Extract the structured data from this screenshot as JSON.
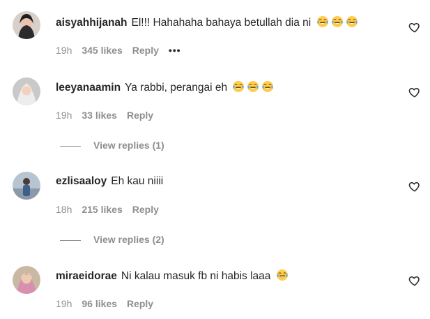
{
  "comments": [
    {
      "username": "aisyahhijanah",
      "text": "El!!! Hahahaha bahaya betullah dia ni",
      "emojis": [
        "face-with-tears-of-joy",
        "face-with-tears-of-joy",
        "face-with-tears-of-joy"
      ],
      "time": "19h",
      "likes": "345 likes",
      "reply_label": "Reply",
      "more_label": "•••"
    },
    {
      "username": "leeyanaamin",
      "text": "Ya rabbi, perangai eh",
      "emojis": [
        "face-with-tears-of-joy",
        "face-with-tears-of-joy",
        "face-with-tears-of-joy"
      ],
      "time": "19h",
      "likes": "33 likes",
      "reply_label": "Reply",
      "view_replies": "View replies (1)"
    },
    {
      "username": "ezlisaaloy",
      "text": "Eh kau niiii",
      "emojis": [],
      "time": "18h",
      "likes": "215 likes",
      "reply_label": "Reply",
      "view_replies": "View replies (2)"
    },
    {
      "username": "miraeidorae",
      "text": "Ni kalau masuk fb ni habis laaa",
      "emojis": [
        "face-with-tears-of-joy"
      ],
      "time": "19h",
      "likes": "96 likes",
      "reply_label": "Reply"
    }
  ],
  "icons": {
    "like": "heart-outline-icon",
    "emoji": "face-with-tears-of-joy"
  },
  "colors": {
    "text": "#262626",
    "secondary": "#8e8e8e",
    "background": "#ffffff"
  }
}
